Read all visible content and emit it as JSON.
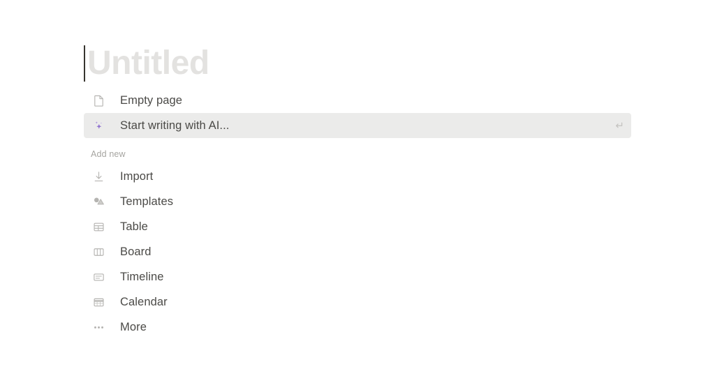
{
  "document": {
    "title_placeholder": "Untitled",
    "caret_visible": true
  },
  "colors": {
    "placeholder_gray": "#e3e2e0",
    "text_gray": "#4b4a47",
    "icon_gray": "#b5b4b1",
    "section_label_gray": "#a6a5a1",
    "selected_row_bg": "#ebebea",
    "ai_accent_purple": "#8f72cf",
    "caret": "#37352f",
    "page_bg": "#ffffff"
  },
  "quick_actions": [
    {
      "id": "empty-page",
      "label": "Empty page",
      "icon": "page-icon",
      "selected": false,
      "shortcut_hint": ""
    },
    {
      "id": "start-writing-with-ai",
      "label": "Start writing with AI...",
      "icon": "sparkle-ai-icon",
      "selected": true,
      "shortcut_hint": "↵"
    }
  ],
  "add_new": {
    "section_label": "Add new",
    "items": [
      {
        "id": "import",
        "label": "Import",
        "icon": "download-arrow-icon"
      },
      {
        "id": "templates",
        "label": "Templates",
        "icon": "shapes-icon"
      },
      {
        "id": "table",
        "label": "Table",
        "icon": "table-grid-icon"
      },
      {
        "id": "board",
        "label": "Board",
        "icon": "board-columns-icon"
      },
      {
        "id": "timeline",
        "label": "Timeline",
        "icon": "timeline-icon"
      },
      {
        "id": "calendar",
        "label": "Calendar",
        "icon": "calendar-icon"
      },
      {
        "id": "more",
        "label": "More",
        "icon": "ellipsis-icon"
      }
    ]
  }
}
